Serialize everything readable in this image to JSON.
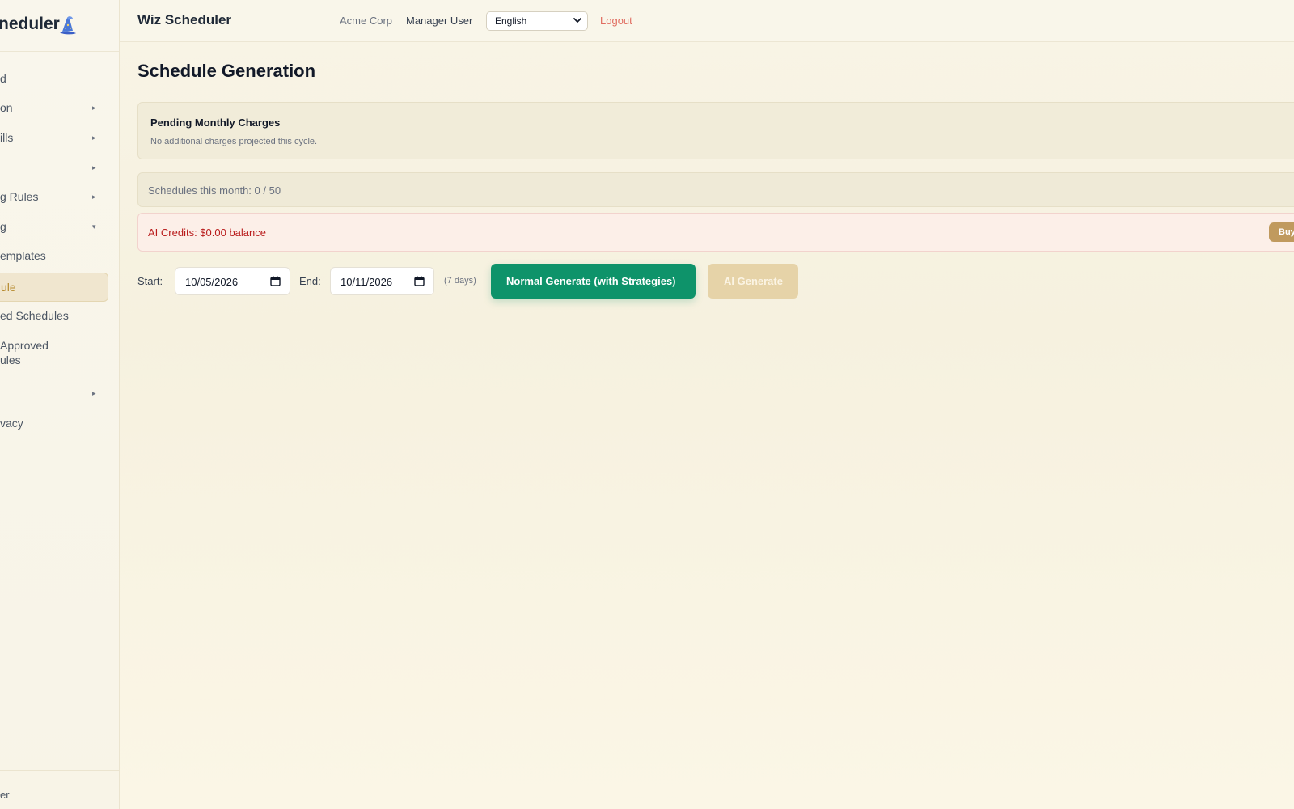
{
  "sidebar": {
    "brand_title": "neduler",
    "brand_icon": "wizard-hat-icon",
    "items": [
      {
        "label": "d",
        "has_arrow": false
      },
      {
        "label": "on",
        "has_arrow": true
      },
      {
        "label": "ills",
        "has_arrow": true
      },
      {
        "label": "",
        "has_arrow": true
      },
      {
        "label": "g Rules",
        "has_arrow": true
      },
      {
        "label": "g",
        "has_arrow": true,
        "arrow": "▾"
      },
      {
        "label": "emplates",
        "has_arrow": false
      },
      {
        "label": "ule",
        "has_arrow": false,
        "active": true
      },
      {
        "label": "ed Schedules",
        "has_arrow": false
      },
      {
        "label_line1": "Approved",
        "label_line2": "ules",
        "has_arrow": false
      },
      {
        "label": "",
        "has_arrow": true
      },
      {
        "label": "vacy",
        "has_arrow": false
      }
    ],
    "arrow_glyph": "▸",
    "arrow_down_glyph": "▾",
    "footer_label": "er"
  },
  "header": {
    "app_title": "Wiz Scheduler",
    "org_name": "Acme Corp",
    "user_name": "Manager User",
    "language": "English",
    "logout_label": "Logout"
  },
  "main": {
    "page_title": "Schedule Generation",
    "charges": {
      "title": "Pending Monthly Charges",
      "subtitle": "No additional charges projected this cycle."
    },
    "usage_text": "Schedules this month: 0 / 50",
    "credits": {
      "text": "AI Credits: $0.00 balance",
      "buy_label": "Buy"
    },
    "controls": {
      "start_label": "Start:",
      "start_value": "10/05/2026",
      "end_label": "End:",
      "end_value": "10/11/2026",
      "days_note": "(7 days)",
      "generate_label": "Normal Generate (with Strategies)",
      "ai_generate_label": "AI Generate"
    }
  },
  "colors": {
    "primary_green": "#0e936a",
    "logout_red": "#e06b5f",
    "credits_red": "#b91c1c",
    "active_gold": "#b68a2e",
    "ai_button_disabled": "#e6d3a8"
  }
}
